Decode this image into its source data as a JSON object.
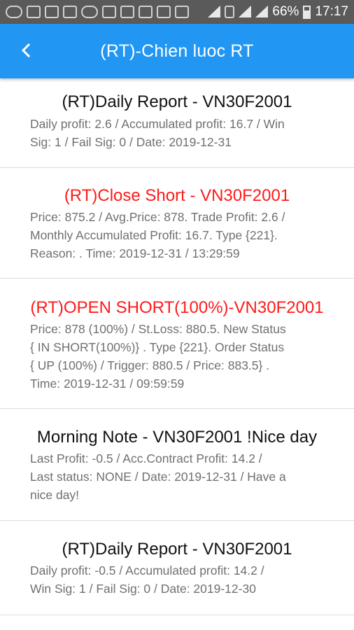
{
  "status_bar": {
    "battery": "66%",
    "time": "17:17"
  },
  "app_bar": {
    "title": "(RT)-Chien luoc RT",
    "back_icon": "chevron-left-icon"
  },
  "colors": {
    "app_bar": "#2196f3",
    "alert_title": "#ff1a1a",
    "body_text": "#707070"
  },
  "items": [
    {
      "title": "(RT)Daily Report - VN30F2001",
      "lines": [
        "Daily profit: 2.6 / Accumulated profit: 16.7 / Win",
        "Sig: 1 / Fail Sig: 0 / Date: 2019-12-31"
      ]
    },
    {
      "title": "(RT)Close Short - VN30F2001",
      "lines": [
        "Price: 875.2 / Avg.Price: 878. Trade Profit: 2.6 /",
        "Monthly Accumulated Profit: 16.7. Type {221}.",
        "Reason: . Time: 2019-12-31 / 13:29:59"
      ]
    },
    {
      "title": "(RT)OPEN SHORT(100%)-VN30F2001",
      "lines": [
        "Price: 878 (100%) / St.Loss: 880.5. New Status",
        "{ IN SHORT(100%)} . Type {221}. Order Status",
        "{ UP (100%) / Trigger: 880.5 / Price: 883.5} .",
        "Time: 2019-12-31 / 09:59:59"
      ]
    },
    {
      "title": "Morning Note - VN30F2001 !Nice day",
      "lines": [
        "Last Profit: -0.5 / Acc.Contract Profit: 14.2 /",
        "Last status: NONE / Date: 2019-12-31 / Have a",
        "nice day!"
      ]
    },
    {
      "title": "(RT)Daily Report - VN30F2001",
      "lines": [
        "Daily profit: -0.5 / Accumulated profit: 14.2 /",
        "Win Sig: 1 / Fail Sig: 0 / Date: 2019-12-30"
      ]
    }
  ]
}
